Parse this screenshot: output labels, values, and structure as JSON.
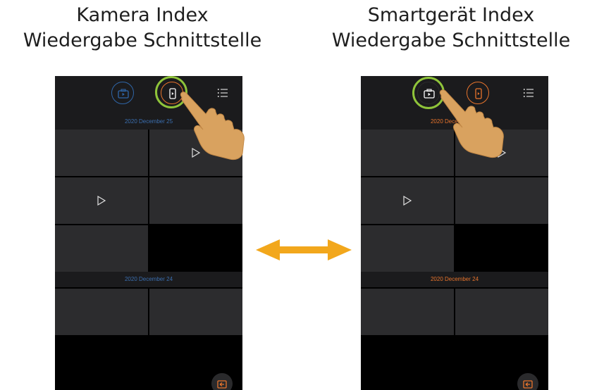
{
  "left_panel": {
    "caption_line1": "Kamera Index",
    "caption_line2": "Wiedergabe Schnittstelle",
    "date_label_1": "2020 December 25",
    "date_label_2": "2020 December 24",
    "date_color": "#3b6fb0",
    "active_mode": "smart-device"
  },
  "right_panel": {
    "caption_line1": "Smartgerät Index",
    "caption_line2": "Wiedergabe Schnittstelle",
    "date_label_1": "2020 December 25",
    "date_label_2": "2020 December 24",
    "date_color": "#e8742c",
    "active_mode": "camera"
  },
  "colors": {
    "camera_accent": "#2f66a8",
    "smart_device_accent": "#e8742c",
    "highlight_ring": "#8fc43a",
    "swap_arrow": "#f2a71c",
    "hand": "#d9a25f"
  },
  "icons": {
    "camera_mode": "camera-play-icon",
    "smart_device_mode": "phone-play-icon",
    "list": "list-icon",
    "play": "play-icon",
    "back": "back-icon",
    "swap": "double-arrow-icon",
    "pointer": "hand-pointer-icon"
  }
}
